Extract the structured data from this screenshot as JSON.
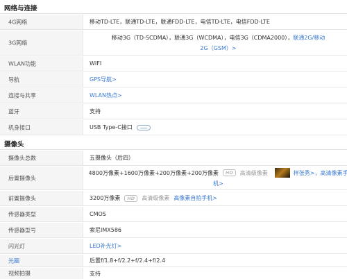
{
  "sections": {
    "network": "网络与连接",
    "camera": "摄像头"
  },
  "network": {
    "net4g": {
      "label": "4G网络",
      "value": "移动TD-LTE，联通TD-LTE，联通FDD-LTE，电信TD-LTE，电信FDD-LTE"
    },
    "net3g": {
      "label": "3G网络",
      "value": "移动3G（TD-SCDMA），联通3G（WCDMA），电信3G（CDMA2000），",
      "link1": "联通2G/移动",
      "link2": "2G（GSM）>"
    },
    "wlan": {
      "label": "WLAN功能",
      "value": "WIFI"
    },
    "nav": {
      "label": "导航",
      "link": "GPS导航>"
    },
    "share": {
      "label": "连接与共享",
      "link": "WLAN热点>"
    },
    "bt": {
      "label": "蓝牙",
      "value": "支持"
    },
    "port": {
      "label": "机身接口",
      "value": "USB Type-C接口",
      "icon": "usb-type-c-icon"
    }
  },
  "camera": {
    "total": {
      "label": "摄像头总数",
      "value": "五摄像头（后四）"
    },
    "rear": {
      "label": "后置摄像头",
      "value": "4800万像素+1600万像素+200万像素+200万像素",
      "badge": "HD",
      "quality": "高清级像素",
      "link1": "样张秀>，高清像素手",
      "link2": "机>"
    },
    "front": {
      "label": "前置摄像头",
      "value": "3200万像素",
      "badge": "HD",
      "quality": "高清级像素",
      "link": "高像素自拍手机>"
    },
    "sensor_type": {
      "label": "传感器类型",
      "value": "CMOS"
    },
    "sensor_model": {
      "label": "传感器型号",
      "value": "索尼IMX586"
    },
    "flash": {
      "label": "闪光灯",
      "link": "LED补光灯>"
    },
    "aperture": {
      "label": "光圈",
      "value": "后置f/1.8+f/2.2+f/2.4+f/2.4"
    },
    "video": {
      "label": "视频拍摄",
      "value": "支持"
    }
  }
}
